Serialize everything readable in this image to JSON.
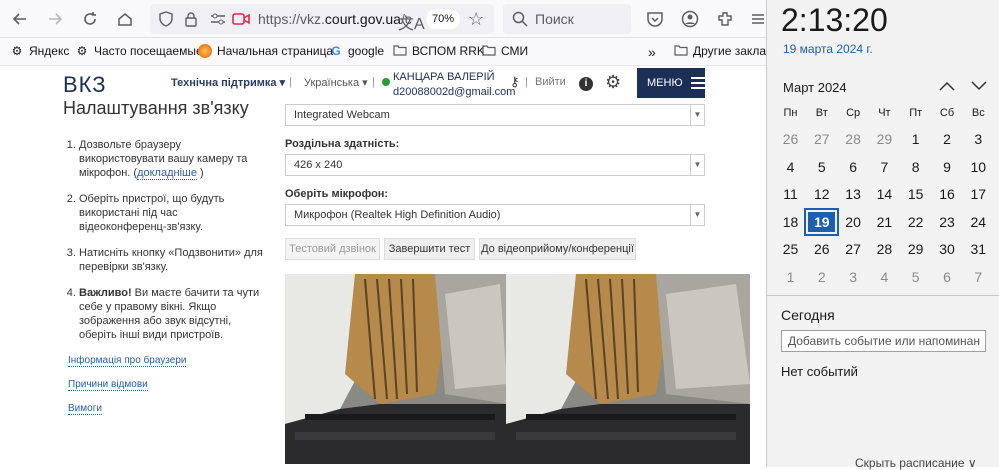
{
  "browser": {
    "url_prefix": "https://vkz.",
    "url_domain": "court.gov.ua",
    "url_suffix": "/c",
    "zoom": "70%",
    "search_placeholder": "Поиск"
  },
  "bookmarks": [
    {
      "label": "Яндекс",
      "icon": "gear-icon"
    },
    {
      "label": "Часто посещаемые",
      "icon": "gear-icon"
    },
    {
      "label": "Начальная страница",
      "icon": "firefox-icon"
    },
    {
      "label": "google",
      "icon": "google-icon"
    },
    {
      "label": "ВСПОМ RRK",
      "icon": "folder-icon"
    },
    {
      "label": "СМИ",
      "icon": "folder-icon"
    },
    {
      "label": "Другие закладк",
      "icon": "folder-icon"
    }
  ],
  "site": {
    "logo": "ВКЗ",
    "support": "Технічна підтримка ▾",
    "language": "Українська ▾",
    "user_name": "КАНЦАРА ВАЛЕРІЙ",
    "user_email": "d20088002d@gmail.com",
    "logout": "Вийти",
    "menu": "МЕНЮ",
    "title": "Налаштування зв'язку"
  },
  "steps": [
    {
      "text": "Дозвольте браузеру використовувати вашу камеру та мікрофон. (",
      "link": "докладніше",
      "after": " )"
    },
    {
      "text": "Оберіть пристрої, що будуть використані під час відеоконференц-зв'язку."
    },
    {
      "text": "Натисніть кнопку «Подзвонити» для перевірки зв'язку."
    },
    {
      "bold": "Важливо!",
      "text": " Ви маєте бачити та чути себе у правому вікні. Якщо зображення або звук відсутні, оберіть інші види пристроїв."
    }
  ],
  "side_links": [
    "Інформація про браузери",
    "Причини відмови",
    "Вимоги"
  ],
  "form": {
    "camera_value": "Integrated Webcam",
    "resolution_label": "Роздільна здатність:",
    "resolution_value": "426 x 240",
    "mic_label": "Оберіть мікрофон:",
    "mic_value": "Микрофон (Realtek High Definition Audio)",
    "btn_test": "Тестовий дзвінок",
    "btn_end": "Завершити тест",
    "btn_conf": "До відеоприйому/конференції"
  },
  "calendar": {
    "time": "2:13:20",
    "date": "19 марта 2024 г.",
    "month": "Март 2024",
    "weekdays": [
      "Пн",
      "Вт",
      "Ср",
      "Чт",
      "Пт",
      "Сб",
      "Вс"
    ],
    "weeks": [
      [
        "26",
        "27",
        "28",
        "29",
        "1",
        "2",
        "3"
      ],
      [
        "4",
        "5",
        "6",
        "7",
        "8",
        "9",
        "10"
      ],
      [
        "11",
        "12",
        "13",
        "14",
        "15",
        "16",
        "17"
      ],
      [
        "18",
        "19",
        "20",
        "21",
        "22",
        "23",
        "24"
      ],
      [
        "25",
        "26",
        "27",
        "28",
        "29",
        "30",
        "31"
      ],
      [
        "1",
        "2",
        "3",
        "4",
        "5",
        "6",
        "7"
      ]
    ],
    "today_label": "Сегодня",
    "event_placeholder": "Добавить событие или напоминан",
    "no_events": "Нет событий",
    "hide_schedule": "Скрыть расписание ∨"
  }
}
